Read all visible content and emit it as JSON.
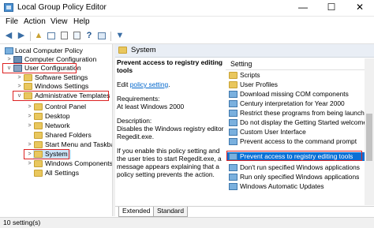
{
  "window": {
    "title": "Local Group Policy Editor",
    "minimize": "—",
    "maximize": "☐",
    "close": "✕"
  },
  "menu": [
    "File",
    "Action",
    "View",
    "Help"
  ],
  "toolbar": {
    "back": "◀",
    "forward": "▶",
    "up": "▲",
    "filter": "▼"
  },
  "tree": [
    {
      "label": "Local Computer Policy"
    },
    {
      "label": "Computer Configuration"
    },
    {
      "label": "User Configuration"
    },
    {
      "label": "Software Settings"
    },
    {
      "label": "Windows Settings"
    },
    {
      "label": "Administrative Templates"
    },
    {
      "label": "Control Panel"
    },
    {
      "label": "Desktop"
    },
    {
      "label": "Network"
    },
    {
      "label": "Shared Folders"
    },
    {
      "label": "Start Menu and Taskbar"
    },
    {
      "label": "System"
    },
    {
      "label": "Windows Components"
    },
    {
      "label": "All Settings"
    }
  ],
  "header": {
    "title": "System"
  },
  "description": {
    "title": "Prevent access to registry editing tools",
    "edit_prefix": "Edit ",
    "edit_link": "policy setting",
    "edit_suffix": ".",
    "requirements_label": "Requirements:",
    "requirements_value": "At least Windows 2000",
    "description_label": "Description:",
    "description_value": "Disables the Windows registry editor Regedit.exe.",
    "extra": "If you enable this policy setting and the user tries to start Regedit.exe, a message appears explaining that a policy setting prevents the action."
  },
  "list": {
    "column": "Setting",
    "items": [
      {
        "label": "Scripts",
        "type": "folder"
      },
      {
        "label": "User Profiles",
        "type": "folder"
      },
      {
        "label": "Download missing COM components",
        "type": "policy"
      },
      {
        "label": "Century interpretation for Year 2000",
        "type": "policy"
      },
      {
        "label": "Restrict these programs from being launched",
        "type": "policy"
      },
      {
        "label": "Do not display the Getting Started welcome",
        "type": "policy"
      },
      {
        "label": "Custom User Interface",
        "type": "policy"
      },
      {
        "label": "Prevent access to the command prompt",
        "type": "policy"
      },
      {
        "label": "Prevent access to registry editing tools",
        "type": "policy"
      },
      {
        "label": "Don't run specified Windows applications",
        "type": "policy"
      },
      {
        "label": "Run only specified Windows applications",
        "type": "policy"
      },
      {
        "label": "Windows Automatic Updates",
        "type": "policy"
      }
    ]
  },
  "tabs": [
    "Extended",
    "Standard"
  ],
  "status": "10 setting(s)",
  "colors": {
    "selection": "#0a70d6",
    "highlight_box": "#dd2222",
    "folder": "#e9c75e"
  }
}
